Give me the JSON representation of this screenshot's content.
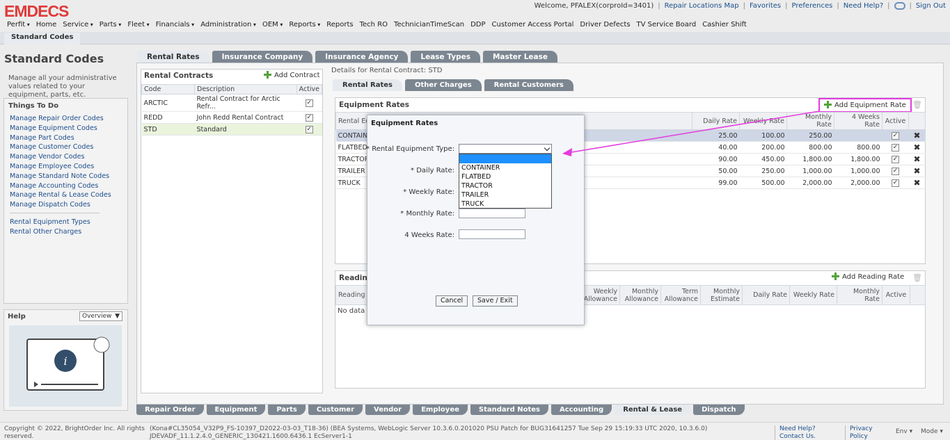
{
  "app": {
    "logo": "EMDECS"
  },
  "toplinks": {
    "welcome": "Welcome, PFALEX(corproId=3401)",
    "repair_map": "Repair Locations Map",
    "favorites": "Favorites",
    "preferences": "Preferences",
    "need_help": "Need Help?",
    "sign_out": "Sign Out"
  },
  "menu": [
    "Perfit",
    "Home",
    "Service",
    "Parts",
    "Fleet",
    "Financials",
    "Administration",
    "OEM",
    "Reports",
    "Reports",
    "Tech RO",
    "TechnicianTimeScan",
    "DDP",
    "Customer Access Portal",
    "Driver Defects",
    "TV Service Board",
    "Cashier Shift"
  ],
  "breadcrumb": "Standard Codes",
  "left": {
    "title": "Standard Codes",
    "description": "Manage all your administrative values related to your equipment, parts, etc.",
    "todo_title": "Things To Do",
    "todo_links": [
      "Manage Repair Order Codes",
      "Manage Equipment Codes",
      "Manage Part Codes",
      "Manage Customer Codes",
      "Manage Vendor Codes",
      "Manage Employee Codes",
      "Manage Standard Note Codes",
      "Manage Accounting Codes",
      "Manage Rental & Lease Codes",
      "Manage Dispatch Codes"
    ],
    "extra_links": [
      "Rental Equipment Types",
      "Rental Other Charges"
    ],
    "help_title": "Help",
    "help_select": "Overview"
  },
  "main_tabs": [
    "Rental Rates",
    "Insurance Company",
    "Insurance Agency",
    "Lease Types",
    "Master Lease"
  ],
  "rental_contracts": {
    "title": "Rental Contracts",
    "add_label": "Add Contract",
    "columns": [
      "Code",
      "Description",
      "Active"
    ],
    "rows": [
      {
        "code": "ARCTIC",
        "desc": "Rental Contract for Arctic Refr..."
      },
      {
        "code": "REDD",
        "desc": "John Redd Rental Contract"
      },
      {
        "code": "STD",
        "desc": "Standard"
      }
    ]
  },
  "details_label": "Details for Rental Contract: STD",
  "sub_tabs": [
    "Rental Rates",
    "Other Charges",
    "Rental Customers"
  ],
  "equipment_rates": {
    "title": "Equipment Rates",
    "add_label": "Add Equipment Rate",
    "columns": [
      "Rental Eq",
      "Daily Rate",
      "Weekly Rate",
      "Monthly Rate",
      "4 Weeks Rate",
      "Active"
    ],
    "rows": [
      {
        "type": "CONTAIN",
        "daily": "25.00",
        "weekly": "100.00",
        "monthly": "250.00",
        "four": ""
      },
      {
        "type": "FLATBED",
        "daily": "40.00",
        "weekly": "200.00",
        "monthly": "800.00",
        "four": "800.00"
      },
      {
        "type": "TRACTOR",
        "daily": "90.00",
        "weekly": "450.00",
        "monthly": "1,800.00",
        "four": "1,800.00"
      },
      {
        "type": "TRAILER",
        "daily": "50.00",
        "weekly": "250.00",
        "monthly": "1,000.00",
        "four": "1,000.00"
      },
      {
        "type": "TRUCK",
        "daily": "99.00",
        "weekly": "500.00",
        "monthly": "2,000.00",
        "four": "2,000.00"
      }
    ]
  },
  "reading_rates": {
    "title": "Reading",
    "add_label": "Add Reading Rate",
    "columns": [
      "Reading T",
      "Weekly Allowance",
      "Monthly Allowance",
      "Term Allowance",
      "Monthly Estimate",
      "Daily Rate",
      "Weekly Rate",
      "Monthly Rate",
      "Active"
    ],
    "no_data": "No data to"
  },
  "modal": {
    "title": "Equipment Rates",
    "type_label": "* Rental Equipment Type:",
    "daily_label": "* Daily Rate:",
    "weekly_label": "* Weekly Rate:",
    "monthly_label": "* Monthly Rate:",
    "four_label": "4 Weeks Rate:",
    "options": [
      "",
      "CONTAINER",
      "FLATBED",
      "TRACTOR",
      "TRAILER",
      "TRUCK"
    ],
    "cancel": "Cancel",
    "save": "Save / Exit"
  },
  "bottom_tabs": [
    "Repair Order",
    "Equipment",
    "Parts",
    "Customer",
    "Vendor",
    "Employee",
    "Standard Notes",
    "Accounting",
    "Rental & Lease",
    "Dispatch"
  ],
  "footer": {
    "copyright": "Copyright © 2022, BrightOrder Inc. All rights reserved.",
    "build": "(Kona#CL35054_V32P9_FS-10397_D2022-03-03_T18-36) (BEA Systems, WebLogic Server 10.3.6.0.201020 PSU Patch for BUG31641257 Tue Sep 29 15:19:33 UTC 2020, 10.3.6.0) JDEVADF_11.1.2.4.0_GENERIC_130421.1600.6436.1 EcServer1-1",
    "help": "Need Help? Contact Us.",
    "privacy": "Privacy Policy",
    "env": "Env",
    "mode": "Mode"
  },
  "colors": {
    "accent": "#e43be0",
    "logo": "#e03b3b",
    "selected_row": "#cfd6e6",
    "dropdown_highlight": "#1e90ff"
  }
}
